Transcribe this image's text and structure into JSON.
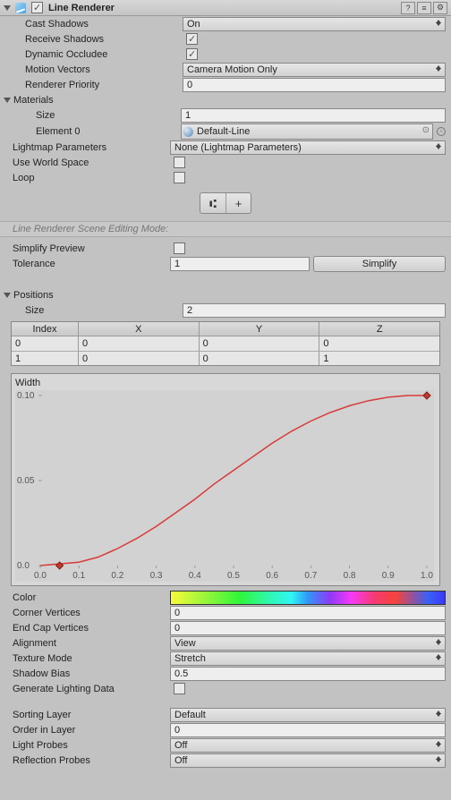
{
  "header": {
    "title": "Line Renderer",
    "enabled": true
  },
  "props": {
    "castShadows": {
      "label": "Cast Shadows",
      "value": "On"
    },
    "receiveShadows": {
      "label": "Receive Shadows",
      "checked": true
    },
    "dynamicOccludee": {
      "label": "Dynamic Occludee",
      "checked": true
    },
    "motionVectors": {
      "label": "Motion Vectors",
      "value": "Camera Motion Only"
    },
    "rendererPriority": {
      "label": "Renderer Priority",
      "value": "0"
    },
    "materials": {
      "label": "Materials",
      "size": {
        "label": "Size",
        "value": "1"
      },
      "element0": {
        "label": "Element 0",
        "value": "Default-Line"
      }
    },
    "lightmapParams": {
      "label": "Lightmap Parameters",
      "value": "None (Lightmap Parameters)"
    },
    "useWorldSpace": {
      "label": "Use World Space",
      "checked": false
    },
    "loop": {
      "label": "Loop",
      "checked": false
    },
    "sceneEditHint": "Line Renderer Scene Editing Mode:",
    "simplifyPreview": {
      "label": "Simplify Preview",
      "checked": false
    },
    "tolerance": {
      "label": "Tolerance",
      "value": "1",
      "button": "Simplify"
    },
    "positions": {
      "label": "Positions",
      "size": {
        "label": "Size",
        "value": "2"
      },
      "headers": {
        "index": "Index",
        "x": "X",
        "y": "Y",
        "z": "Z"
      },
      "rows": [
        {
          "i": "0",
          "x": "0",
          "y": "0",
          "z": "0"
        },
        {
          "i": "1",
          "x": "0",
          "y": "0",
          "z": "1"
        }
      ]
    },
    "widthCurve": {
      "label": "Width"
    },
    "color": {
      "label": "Color"
    },
    "cornerVerts": {
      "label": "Corner Vertices",
      "value": "0"
    },
    "endCapVerts": {
      "label": "End Cap Vertices",
      "value": "0"
    },
    "alignment": {
      "label": "Alignment",
      "value": "View"
    },
    "textureMode": {
      "label": "Texture Mode",
      "value": "Stretch"
    },
    "shadowBias": {
      "label": "Shadow Bias",
      "value": "0.5"
    },
    "genLighting": {
      "label": "Generate Lighting Data",
      "checked": false
    },
    "sortingLayer": {
      "label": "Sorting Layer",
      "value": "Default"
    },
    "orderInLayer": {
      "label": "Order in Layer",
      "value": "0"
    },
    "lightProbes": {
      "label": "Light Probes",
      "value": "Off"
    },
    "reflectionProbes": {
      "label": "Reflection Probes",
      "value": "Off"
    }
  },
  "chart_data": {
    "type": "line",
    "title": "Width",
    "xlabel": "",
    "ylabel": "",
    "xlim": [
      0.0,
      1.0
    ],
    "ylim": [
      0.0,
      0.1
    ],
    "xticks": [
      "0.0",
      "0.1",
      "0.2",
      "0.3",
      "0.4",
      "0.5",
      "0.6",
      "0.7",
      "0.8",
      "0.9",
      "1.0"
    ],
    "yticks": [
      "0.0",
      "0.05",
      "0.10"
    ],
    "series": [
      {
        "name": "width",
        "x": [
          0.0,
          0.05,
          0.1,
          0.15,
          0.2,
          0.25,
          0.3,
          0.35,
          0.4,
          0.45,
          0.5,
          0.55,
          0.6,
          0.65,
          0.7,
          0.75,
          0.8,
          0.85,
          0.9,
          0.95,
          1.0
        ],
        "values": [
          0.0,
          0.001,
          0.002,
          0.005,
          0.01,
          0.016,
          0.023,
          0.031,
          0.039,
          0.048,
          0.056,
          0.064,
          0.072,
          0.079,
          0.085,
          0.09,
          0.094,
          0.097,
          0.099,
          0.1,
          0.1
        ]
      }
    ],
    "keys": [
      {
        "x": 0.05,
        "y": 0.0
      },
      {
        "x": 1.0,
        "y": 0.1
      }
    ]
  }
}
